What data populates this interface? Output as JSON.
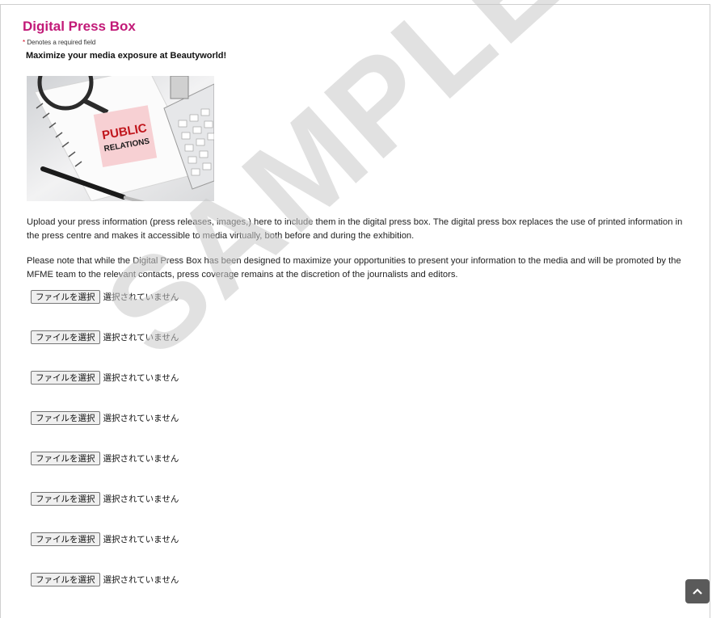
{
  "form": {
    "title": "Digital Press Box",
    "required_star": "*",
    "required_note": " Denotes a required field",
    "headline": "Maximize your media exposure at Beautyworld!",
    "image": {
      "sticky_note_line1": "PUBLIC",
      "sticky_note_line2": "RELATIONS"
    },
    "paragraph1": "Upload your press information (press releases, images,) here to include them in the digital press box. The digital press box replaces the use of printed information in the press centre and makes it accessible to media virtually, both before and during the exhibition.",
    "paragraph2": "Please note that while the Digital Press Box has been designed to maximize your opportunities to present your information to the media and will be promoted by the MFME team to the relevant contacts, press coverage remains at the discretion of the journalists and editors.",
    "uploads": [
      {
        "button": "ファイルを選択",
        "status": "選択されていません"
      },
      {
        "button": "ファイルを選択",
        "status": "選択されていません"
      },
      {
        "button": "ファイルを選択",
        "status": "選択されていません"
      },
      {
        "button": "ファイルを選択",
        "status": "選択されていません"
      },
      {
        "button": "ファイルを選択",
        "status": "選択されていません"
      },
      {
        "button": "ファイルを選択",
        "status": "選択されていません"
      },
      {
        "button": "ファイルを選択",
        "status": "選択されていません"
      },
      {
        "button": "ファイルを選択",
        "status": "選択されていません"
      }
    ]
  },
  "watermark": "SAMPLE",
  "scroll_top_icon": "chevron-up-icon",
  "colors": {
    "title": "#c21a78",
    "required_star": "#d0021b",
    "scroll_button": "#5a5a5a"
  }
}
